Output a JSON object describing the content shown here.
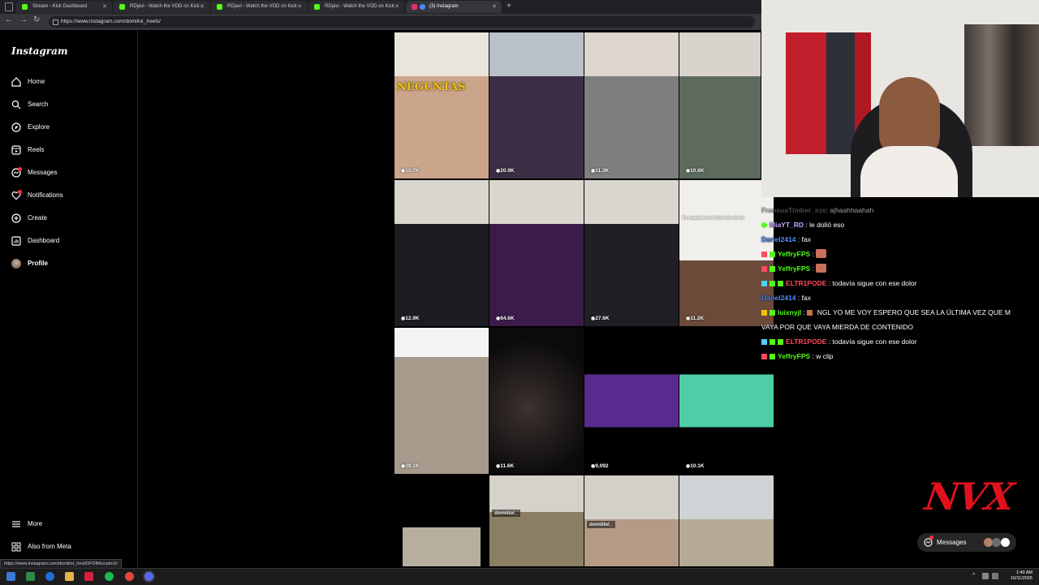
{
  "browser": {
    "tabs": [
      {
        "label": "Stream - Kick Dashboard",
        "favicon_color": "#53fc18"
      },
      {
        "label": "RDjavi - Watch the VOD on Kick",
        "favicon_color": "#53fc18"
      },
      {
        "label": "RDjavi - Watch the VOD on Kick",
        "favicon_color": "#53fc18"
      },
      {
        "label": "RDjavi - Watch the VOD on Kick",
        "favicon_color": "#53fc18"
      },
      {
        "label": "(3) Instagram",
        "favicon_color": "#e1306c"
      }
    ],
    "url": "https://www.instagram.com/domiilol_/reels/",
    "hover_url": "https://www.instagram.com/domiilol_/reel/DFDfMxcudmX/"
  },
  "sidebar": {
    "logo": "Instagram",
    "items": [
      {
        "label": "Home",
        "icon": "home-icon"
      },
      {
        "label": "Search",
        "icon": "search-icon"
      },
      {
        "label": "Explore",
        "icon": "explore-icon"
      },
      {
        "label": "Reels",
        "icon": "reels-icon"
      },
      {
        "label": "Messages",
        "icon": "messages-icon"
      },
      {
        "label": "Notifications",
        "icon": "heart-icon"
      },
      {
        "label": "Create",
        "icon": "plus-icon"
      },
      {
        "label": "Dashboard",
        "icon": "dashboard-icon"
      },
      {
        "label": "Profile",
        "icon": "avatar"
      }
    ],
    "more": "More",
    "meta": "Also from Meta"
  },
  "reels": {
    "counts": [
      "10.7K",
      "20.9K",
      "11.3K",
      "10.6K",
      "12.9K",
      "64.6K",
      "27.6K",
      "11.2K",
      "39.1K",
      "11.6K",
      "9,092",
      "10.1K"
    ],
    "captions": {
      "tile1": "NEGUNTAS",
      "tile4": "To cuando ves fotos de mi ex",
      "tile13": "domiilol_",
      "tile14": "domiilol_"
    }
  },
  "chat": {
    "messages": [
      {
        "user": "FransuaTimber_eze",
        "text": "ajhaahhaahah",
        "color": "#7a7a7a"
      },
      {
        "user": "MiaYT_RD",
        "text": "le dolió eso",
        "color": "#c8a4ff"
      },
      {
        "user": "Dariel2414",
        "text": "fax",
        "color": "#4f8cff"
      },
      {
        "user": "YeffryFPS",
        "text": "",
        "color": "#53fc18"
      },
      {
        "user": "YeffryFPS",
        "text": "",
        "color": "#53fc18"
      },
      {
        "user": "ELTR1PODE",
        "text": "todavía sigue con ese dolor",
        "color": "#ff4b5c"
      },
      {
        "user": "Dariel2414",
        "text": "fax",
        "color": "#4f8cff"
      },
      {
        "user": "luixnyjl",
        "text": "NGL YO ME VOY ESPERO QUE SEA LA ÚLTIMA VEZ QUE M",
        "color": "#53fc18"
      },
      {
        "user": "",
        "text": "VAYA POR QUE VAYA MIERDA DE CONTENIDO",
        "color": "#ffffff"
      },
      {
        "user": "ELTR1PODE",
        "text": "todavía sigue con ese dolor",
        "color": "#ff4b5c"
      },
      {
        "user": "YeffryFPS",
        "text": "w clip",
        "color": "#53fc18"
      }
    ]
  },
  "overlay": {
    "brand": "NVX",
    "messages_label": "Messages"
  },
  "taskbar": {
    "time": "1:40 AM",
    "date": "10/11/2025"
  }
}
